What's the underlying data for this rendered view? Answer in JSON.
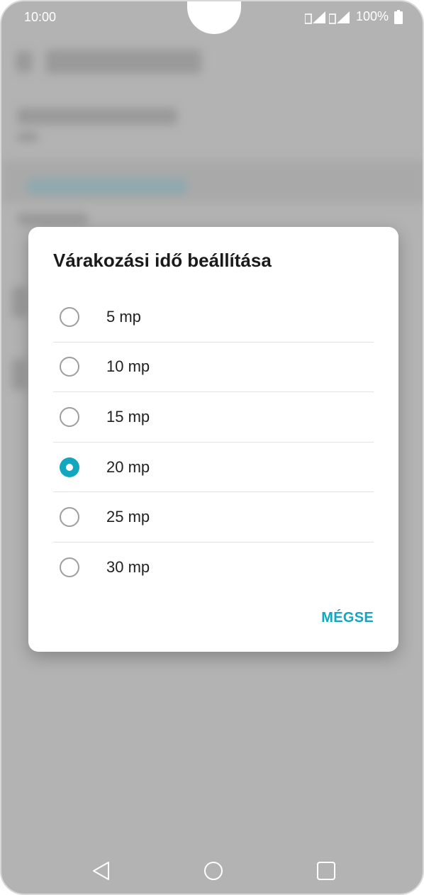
{
  "status_bar": {
    "time": "10:00",
    "battery": "100%"
  },
  "dialog": {
    "title": "Várakozási idő beállítása",
    "options": [
      {
        "label": "5 mp",
        "selected": false
      },
      {
        "label": "10 mp",
        "selected": false
      },
      {
        "label": "15 mp",
        "selected": false
      },
      {
        "label": "20 mp",
        "selected": true
      },
      {
        "label": "25 mp",
        "selected": false
      },
      {
        "label": "30 mp",
        "selected": false
      }
    ],
    "cancel_label": "MÉGSE"
  },
  "colors": {
    "accent": "#12a6bf",
    "scrim": "#b3b3b3"
  },
  "nav": {
    "back_icon": "back-triangle-icon",
    "home_icon": "home-circle-icon",
    "recents_icon": "recents-square-icon"
  }
}
